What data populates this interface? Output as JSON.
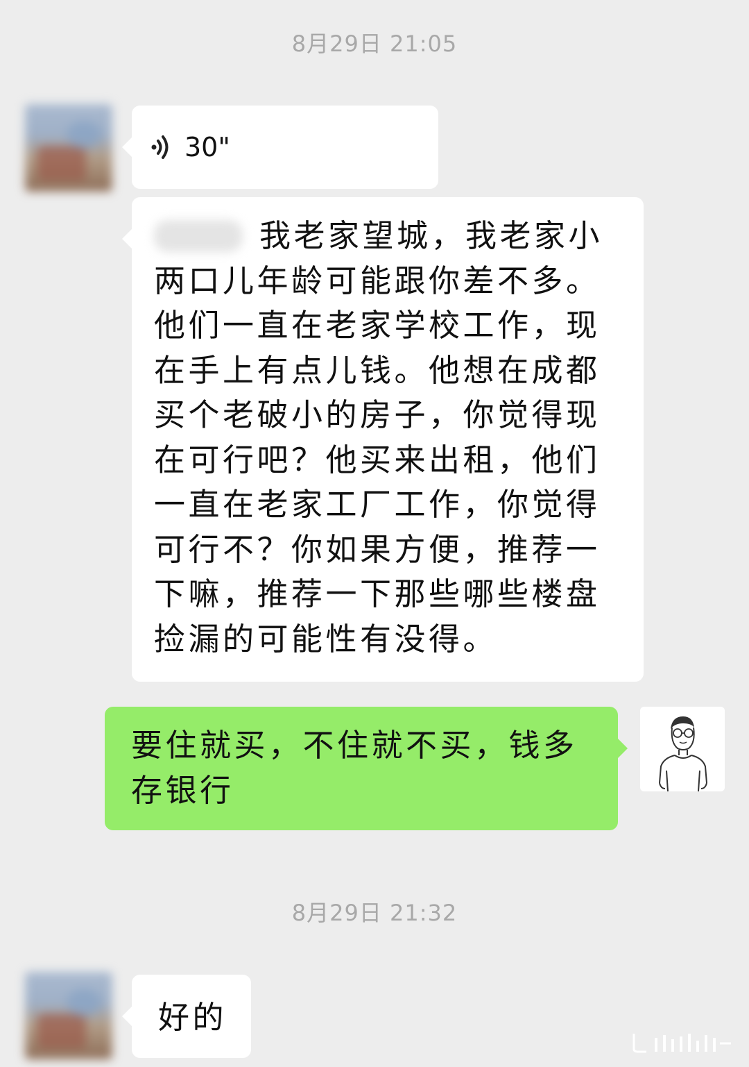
{
  "timestamps": [
    "8月29日 21:05",
    "8月29日 21:32"
  ],
  "messages": [
    {
      "type": "voice",
      "side": "left",
      "duration": "30\""
    },
    {
      "type": "text",
      "side": "left",
      "text": "我老家望城，我老家小两口儿年龄可能跟你差不多。他们一直在老家学校工作，现在手上有点儿钱。他想在成都买个老破小的房子，你觉得现在可行吧？他买来出租，他们一直在老家工厂工作，你觉得可行不？你如果方便，推荐一下嘛，推荐一下那些哪些楼盘捡漏的可能性有没得。"
    },
    {
      "type": "text",
      "side": "right",
      "text": "要住就买，不住就不买，钱多存银行"
    },
    {
      "type": "text",
      "side": "left",
      "text": "好的"
    }
  ],
  "colors": {
    "background": "#ededed",
    "incoming_bubble": "#ffffff",
    "outgoing_bubble": "#95ec69",
    "timestamp": "#a8a8a8"
  },
  "icons": {
    "voice": "voice-wave-icon",
    "my_avatar": "person-sketch-avatar"
  }
}
